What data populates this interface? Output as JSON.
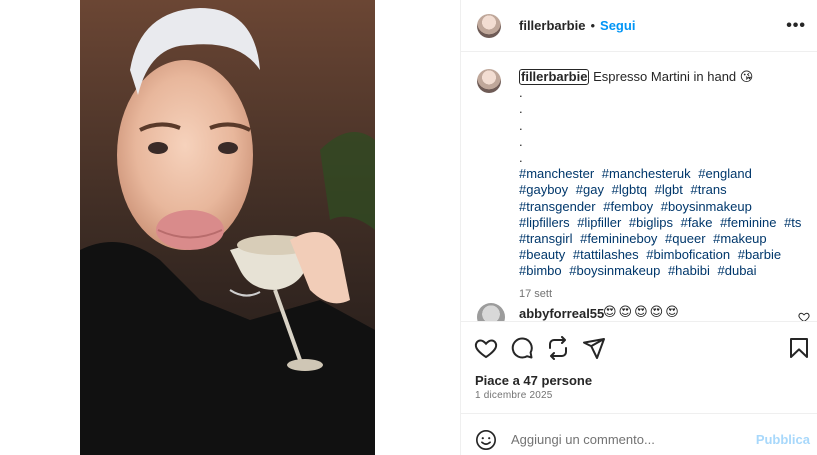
{
  "post": {
    "username": "fillerbarbie",
    "separator": "•",
    "follow_label": "Segui",
    "more_icon": "more-options-icon",
    "more_label": "•••"
  },
  "caption": {
    "username": "fillerbarbie",
    "text": "Espresso Martini in hand 😘",
    "dots": [
      ".",
      ".",
      ".",
      ".",
      "."
    ],
    "hashtags": [
      "#manchester",
      "#manchesteruk",
      "#england",
      "#gayboy",
      "#gay",
      "#lgbtq",
      "#lgbt",
      "#trans",
      "#transgender",
      "#femboy",
      "#boysinmakeup",
      "#lipfillers",
      "#lipfiller",
      "#biglips",
      "#fake",
      "#feminine",
      "#ts",
      "#transgirl",
      "#feminineboy",
      "#queer",
      "#makeup",
      "#beauty",
      "#tattilashes",
      "#bimbofication",
      "#barbie",
      "#bimbo",
      "#boysinmakeup",
      "#habibi",
      "#dubai"
    ],
    "time": "17 sett"
  },
  "comment": {
    "username": "abbyforreal55",
    "text": "😍😍😍😍😍"
  },
  "actions": {
    "icons": [
      "heart-icon",
      "comment-icon",
      "share-icon",
      "send-icon",
      "bookmark-icon"
    ]
  },
  "likes": "Piace a 47 persone",
  "date": "1 dicembre 2025",
  "add_comment": {
    "placeholder": "Aggiungi un commento...",
    "publish_label": "Pubblica"
  },
  "colors": {
    "link": "#0095f6",
    "hashtag": "#00376b",
    "secondary_text": "#737373",
    "border": "#efefef"
  }
}
